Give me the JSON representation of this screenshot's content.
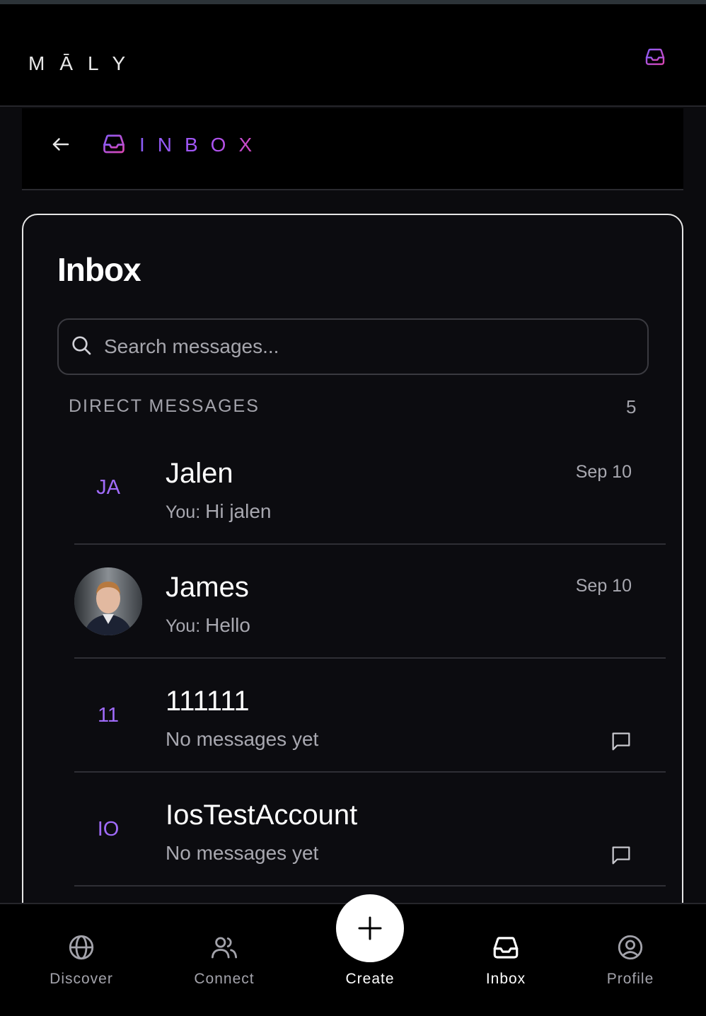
{
  "app": {
    "logo": "MĀLY"
  },
  "subheader": {
    "title": "INBOX"
  },
  "inbox": {
    "title": "Inbox",
    "search": {
      "placeholder": "Search messages..."
    },
    "section": {
      "label": "DIRECT MESSAGES",
      "count": "5"
    },
    "conversations": [
      {
        "initials": "JA",
        "name": "Jalen",
        "date": "Sep 10",
        "prefix": "You: ",
        "preview": "Hi jalen",
        "has_photo": false
      },
      {
        "initials": "",
        "name": "James",
        "date": "Sep 10",
        "prefix": "You: ",
        "preview": "Hello",
        "has_photo": true
      },
      {
        "initials": "11",
        "name": "111111",
        "date": "",
        "prefix": "",
        "preview": "No messages yet",
        "has_photo": false
      },
      {
        "initials": "IO",
        "name": "IosTestAccount",
        "date": "",
        "prefix": "",
        "preview": "No messages yet",
        "has_photo": false
      }
    ]
  },
  "nav": {
    "discover": "Discover",
    "connect": "Connect",
    "create": "Create",
    "inbox": "Inbox",
    "profile": "Profile",
    "active": "Inbox"
  },
  "colors": {
    "accent_purple": "#a06bfa",
    "gradient_start": "#8b5cf6",
    "gradient_end": "#d946b4",
    "background": "#0c0c10"
  },
  "icons": [
    "inbox-icon",
    "back-arrow-icon",
    "search-icon",
    "message-icon",
    "globe-icon",
    "users-icon",
    "plus-icon",
    "user-circle-icon"
  ]
}
